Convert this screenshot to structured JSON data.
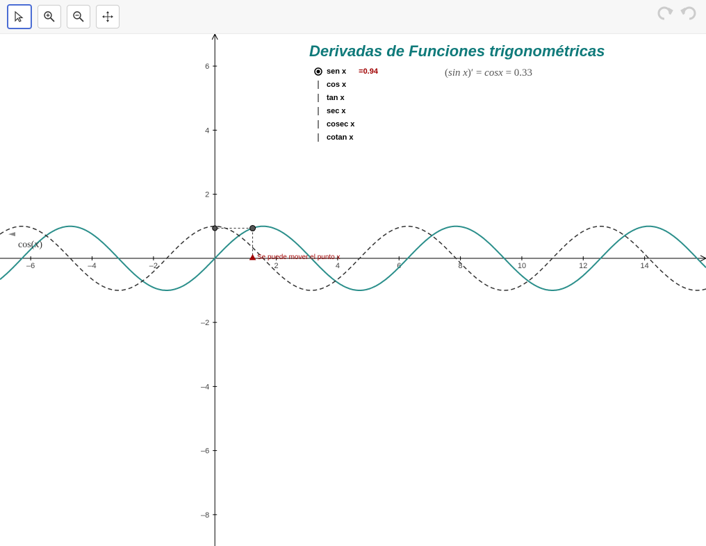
{
  "toolbar": {
    "pointer_tool": "pointer",
    "zoom_in_tool": "zoom-in",
    "zoom_out_tool": "zoom-out",
    "move_tool": "move",
    "undo": "undo",
    "redo": "redo"
  },
  "title": "Derivadas de Funciones trigonométricas",
  "options": [
    {
      "label": "sen x",
      "selected": true,
      "value": "=0.94"
    },
    {
      "label": "cos x",
      "selected": false
    },
    {
      "label": "tan x",
      "selected": false
    },
    {
      "label": "sec x",
      "selected": false
    },
    {
      "label": "cosec x",
      "selected": false
    },
    {
      "label": "cotan x",
      "selected": false
    }
  ],
  "formula": {
    "lhs": "(sin x)′",
    "rhs": "cosx = 0.33"
  },
  "hint": "Se puede mover el punto x",
  "y_axis_aux_label": "cos(x)",
  "point": {
    "x": 1.23,
    "sinx": 0.94,
    "cosx": 0.33
  },
  "colors": {
    "title": "#0f7a7a",
    "sin_curve": "#2b8f8b",
    "cos_curve": "#333333",
    "value_red": "#a00000"
  },
  "chart_data": {
    "type": "line",
    "title": "Derivadas de Funciones trigonométricas",
    "xlabel": "",
    "ylabel": "",
    "xlim": [
      -7,
      16
    ],
    "ylim": [
      -9,
      7
    ],
    "x_ticks": [
      -6,
      -4,
      -2,
      2,
      4,
      6,
      8,
      10,
      12,
      14
    ],
    "y_ticks": [
      -8,
      -6,
      -4,
      -2,
      2,
      4,
      6
    ],
    "series": [
      {
        "name": "sin(x)",
        "style": "solid",
        "color": "#2b8f8b",
        "x": [
          -7,
          -6.5,
          -6,
          -5.5,
          -5,
          -4.5,
          -4,
          -3.5,
          -3,
          -2.5,
          -2,
          -1.5,
          -1,
          -0.5,
          0,
          0.5,
          1,
          1.5,
          2,
          2.5,
          3,
          3.5,
          4,
          4.5,
          5,
          5.5,
          6,
          6.5,
          7,
          7.5,
          8,
          8.5,
          9,
          9.5,
          10,
          10.5,
          11,
          11.5,
          12,
          12.5,
          13,
          13.5,
          14,
          14.5,
          15,
          15.5,
          16
        ],
        "y": [
          -0.657,
          -0.215,
          0.279,
          0.706,
          0.959,
          0.978,
          0.757,
          0.351,
          -0.141,
          -0.599,
          -0.909,
          -0.997,
          -0.841,
          -0.479,
          0.0,
          0.479,
          0.841,
          0.997,
          0.909,
          0.599,
          0.141,
          -0.351,
          -0.757,
          -0.978,
          -0.959,
          -0.706,
          -0.279,
          0.215,
          0.657,
          0.938,
          0.989,
          0.798,
          0.412,
          -0.075,
          -0.544,
          -0.88,
          -1.0,
          -0.876,
          -0.537,
          -0.066,
          0.42,
          0.804,
          0.991,
          0.935,
          0.65,
          0.206,
          -0.288
        ]
      },
      {
        "name": "cos(x)",
        "style": "dashed",
        "color": "#333333",
        "x": [
          -7,
          -6.5,
          -6,
          -5.5,
          -5,
          -4.5,
          -4,
          -3.5,
          -3,
          -2.5,
          -2,
          -1.5,
          -1,
          -0.5,
          0,
          0.5,
          1,
          1.5,
          2,
          2.5,
          3,
          3.5,
          4,
          4.5,
          5,
          5.5,
          6,
          6.5,
          7,
          7.5,
          8,
          8.5,
          9,
          9.5,
          10,
          10.5,
          11,
          11.5,
          12,
          12.5,
          13,
          13.5,
          14,
          14.5,
          15,
          15.5,
          16
        ],
        "y": [
          0.754,
          0.977,
          0.96,
          0.709,
          0.284,
          -0.211,
          -0.654,
          -0.936,
          -0.99,
          -0.801,
          -0.416,
          0.071,
          0.54,
          0.878,
          1.0,
          0.878,
          0.54,
          0.071,
          -0.416,
          -0.801,
          -0.99,
          -0.936,
          -0.654,
          -0.211,
          0.284,
          0.709,
          0.96,
          0.977,
          0.754,
          0.347,
          -0.146,
          -0.602,
          -0.911,
          -0.997,
          -0.839,
          -0.476,
          0.004,
          0.483,
          0.844,
          0.998,
          0.907,
          0.595,
          0.137,
          -0.355,
          -0.76,
          -0.979,
          -0.958
        ]
      }
    ],
    "markers": [
      {
        "label": "P",
        "x": 1.23,
        "y": 0.94
      },
      {
        "label": "x-axis-point",
        "x": 1.23,
        "y": 0
      },
      {
        "label": "y-axis-proj",
        "x": 0,
        "y": 0.94
      }
    ]
  }
}
